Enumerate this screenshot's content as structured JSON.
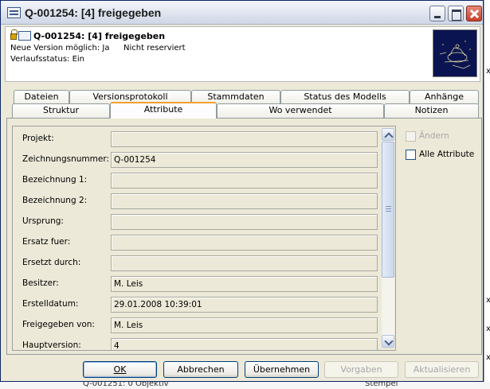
{
  "window": {
    "title": "Q-001254: [4] freigegeben"
  },
  "info": {
    "title": "Q-001254: [4] freigegeben",
    "new_version": "Neue Version möglich: Ja",
    "reserved": "Nicht reserviert",
    "flow_status": "Verlaufsstatus: Ein"
  },
  "tabs_row1": [
    "Dateien",
    "Versionsprotokoll",
    "Stammdaten",
    "Status des Modells",
    "Anhänge"
  ],
  "tabs_row2": [
    "Struktur",
    "Attribute",
    "Wo verwendet",
    "Notizen"
  ],
  "active_tab": "Attribute",
  "attributes": [
    {
      "label": "Projekt:",
      "value": ""
    },
    {
      "label": "Zeichnungsnummer: *",
      "value": "Q-001254"
    },
    {
      "label": "Bezeichnung 1:",
      "value": ""
    },
    {
      "label": "Bezeichnung 2:",
      "value": ""
    },
    {
      "label": "Ursprung:",
      "value": ""
    },
    {
      "label": "Ersatz fuer:",
      "value": ""
    },
    {
      "label": "Ersetzt durch:",
      "value": ""
    },
    {
      "label": "Besitzer:",
      "value": "M. Leis"
    },
    {
      "label": "Erstelldatum:",
      "value": "29.01.2008 10:39:01"
    },
    {
      "label": "Freigegeben von:",
      "value": "M. Leis"
    },
    {
      "label": "Hauptversion:",
      "value": "4"
    }
  ],
  "options": {
    "edit_label": "Ändern",
    "edit_checked": false,
    "edit_enabled": false,
    "all_attributes_label": "Alle Attribute",
    "all_attributes_checked": false
  },
  "buttons": {
    "ok": "OK",
    "cancel": "Abbrechen",
    "apply": "Übernehmen",
    "defaults": "Vorgaben",
    "refresh": "Aktualisieren"
  },
  "background": {
    "right_texts": [
      "x",
      "x",
      "x",
      "x"
    ],
    "bottom_left": "Q-001251: 0 Objektiv",
    "bottom_right": "Stempel"
  },
  "colors": {
    "accent_tab": "#f0a030",
    "dialog_bg": "#ece9d8",
    "titlebar_close": "#c8402a"
  }
}
